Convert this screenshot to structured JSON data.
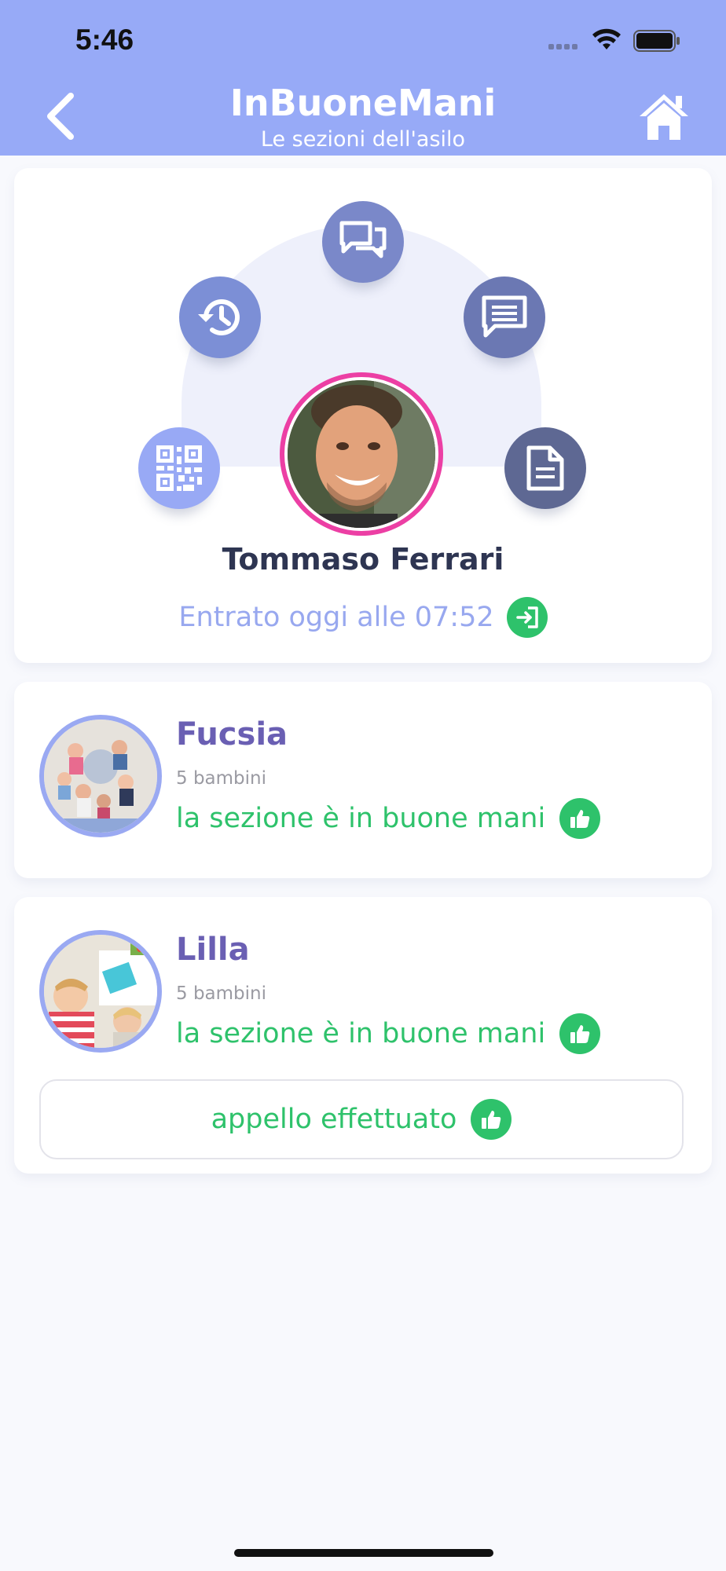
{
  "status_bar": {
    "time": "5:46"
  },
  "header": {
    "title": "InBuoneMani",
    "subtitle": "Le sezioni dell'asilo",
    "back_icon": "chevron-left-icon",
    "home_icon": "home-icon"
  },
  "profile": {
    "name": "Tommaso Ferrari",
    "entry_text": "Entrato oggi alle 07:52",
    "entry_icon": "sign-in-icon",
    "border_color": "#ec3fa4",
    "actions": [
      {
        "icon": "qr-code-icon",
        "color": "#98a9f5"
      },
      {
        "icon": "history-icon",
        "color": "#7c8fd6"
      },
      {
        "icon": "chat-icon",
        "color": "#7a88c9"
      },
      {
        "icon": "message-icon",
        "color": "#6b78b3"
      },
      {
        "icon": "document-icon",
        "color": "#5e6893"
      }
    ]
  },
  "sections": [
    {
      "name": "Fucsia",
      "count": "5 bambini",
      "status": "la sezione è in buone mani",
      "status_icon": "thumbs-up-icon"
    },
    {
      "name": "Lilla",
      "count": "5 bambini",
      "status": "la sezione è in buone mani",
      "status_icon": "thumbs-up-icon",
      "appello_label": "appello effettuato"
    }
  ],
  "colors": {
    "header_bg": "#97aaf7",
    "accent_green": "#2ec26b",
    "section_name": "#6a5fb3"
  }
}
